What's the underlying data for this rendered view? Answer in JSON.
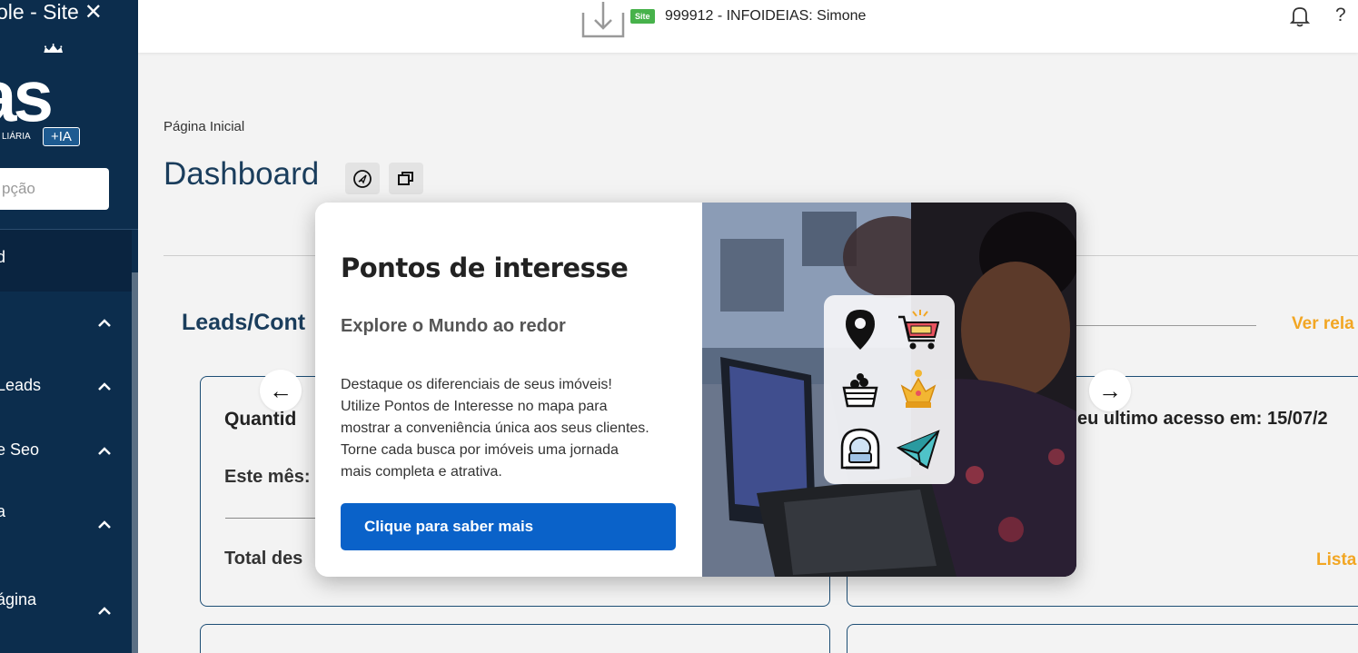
{
  "sidebar": {
    "title": "ole - Site",
    "close_icon": "close-icon",
    "logo_sub": "LIÁRIA",
    "logo_ia": "+IA",
    "search_placeholder": "pção",
    "items": [
      {
        "label": "d",
        "active": true
      },
      {
        "label": ""
      },
      {
        "label": "Leads"
      },
      {
        "label": "e Seo"
      },
      {
        "label": "a"
      },
      {
        "label": "ágina"
      }
    ]
  },
  "header": {
    "site_badge": "Site",
    "account": "999912 - INFOIDEIAS: Simone",
    "help": "?"
  },
  "main": {
    "breadcrumb": "Página Inicial",
    "title": "Dashboard",
    "section_title": "Leads/Cont",
    "see_report": "Ver rela",
    "card1": {
      "heading": "Quantid",
      "this_month": "Este mês:",
      "total": "Total des"
    },
    "card2": {
      "last_access": "eu ultimo acesso em: 15/07/2",
      "list_link": "Lista"
    },
    "prev_arrow": "←",
    "next_arrow": "→"
  },
  "modal": {
    "title": "Pontos de interesse",
    "subtitle": "Explore o Mundo ao redor",
    "body": [
      "Destaque os diferenciais de seus imóveis!",
      "Utilize Pontos de Interesse no mapa para",
      "mostrar a conveniência única aos seus clientes.",
      "Torne cada busca por imóveis uma jornada",
      "mais completa e atrativa."
    ],
    "cta": "Clique para saber mais"
  },
  "colors": {
    "sidebar": "#0c2d4d",
    "accent_orange": "#f2a623",
    "cta_blue": "#0a62c9",
    "title_blue": "#1a3d5c",
    "site_green": "#47b24b"
  }
}
